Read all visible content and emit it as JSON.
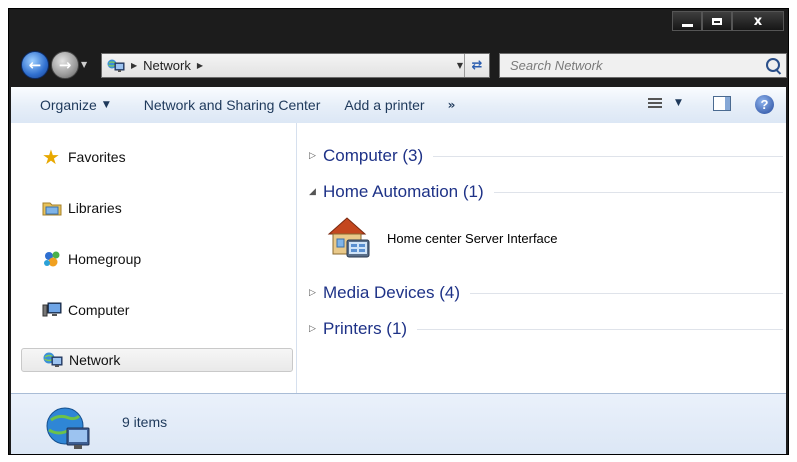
{
  "window": {
    "caption_buttons": {
      "minimize": "minimize",
      "maximize": "maximize",
      "close": "x"
    }
  },
  "address": {
    "breadcrumb": [
      "Network"
    ],
    "search_placeholder": "Search Network"
  },
  "toolbar": {
    "organize": "Organize",
    "network_sharing": "Network and Sharing Center",
    "add_printer": "Add a printer",
    "more": "»"
  },
  "nav": {
    "items": [
      {
        "label": "Favorites",
        "icon": "star-icon"
      },
      {
        "label": "Libraries",
        "icon": "libraries-icon"
      },
      {
        "label": "Homegroup",
        "icon": "homegroup-icon"
      },
      {
        "label": "Computer",
        "icon": "computer-icon"
      },
      {
        "label": "Network",
        "icon": "network-icon",
        "selected": true
      }
    ]
  },
  "content": {
    "groups": [
      {
        "label": "Computer (3)",
        "expanded": false
      },
      {
        "label": "Home Automation (1)",
        "expanded": true
      },
      {
        "label": "Media Devices (4)",
        "expanded": false
      },
      {
        "label": "Printers (1)",
        "expanded": false
      }
    ],
    "items": [
      {
        "label": "Home center Server Interface",
        "icon": "home-server-icon"
      }
    ]
  },
  "details": {
    "count": "9 items"
  },
  "colors": {
    "group_header": "#1e3287",
    "toolbar_text": "#1e395b",
    "accent": "#2f6fcf"
  }
}
